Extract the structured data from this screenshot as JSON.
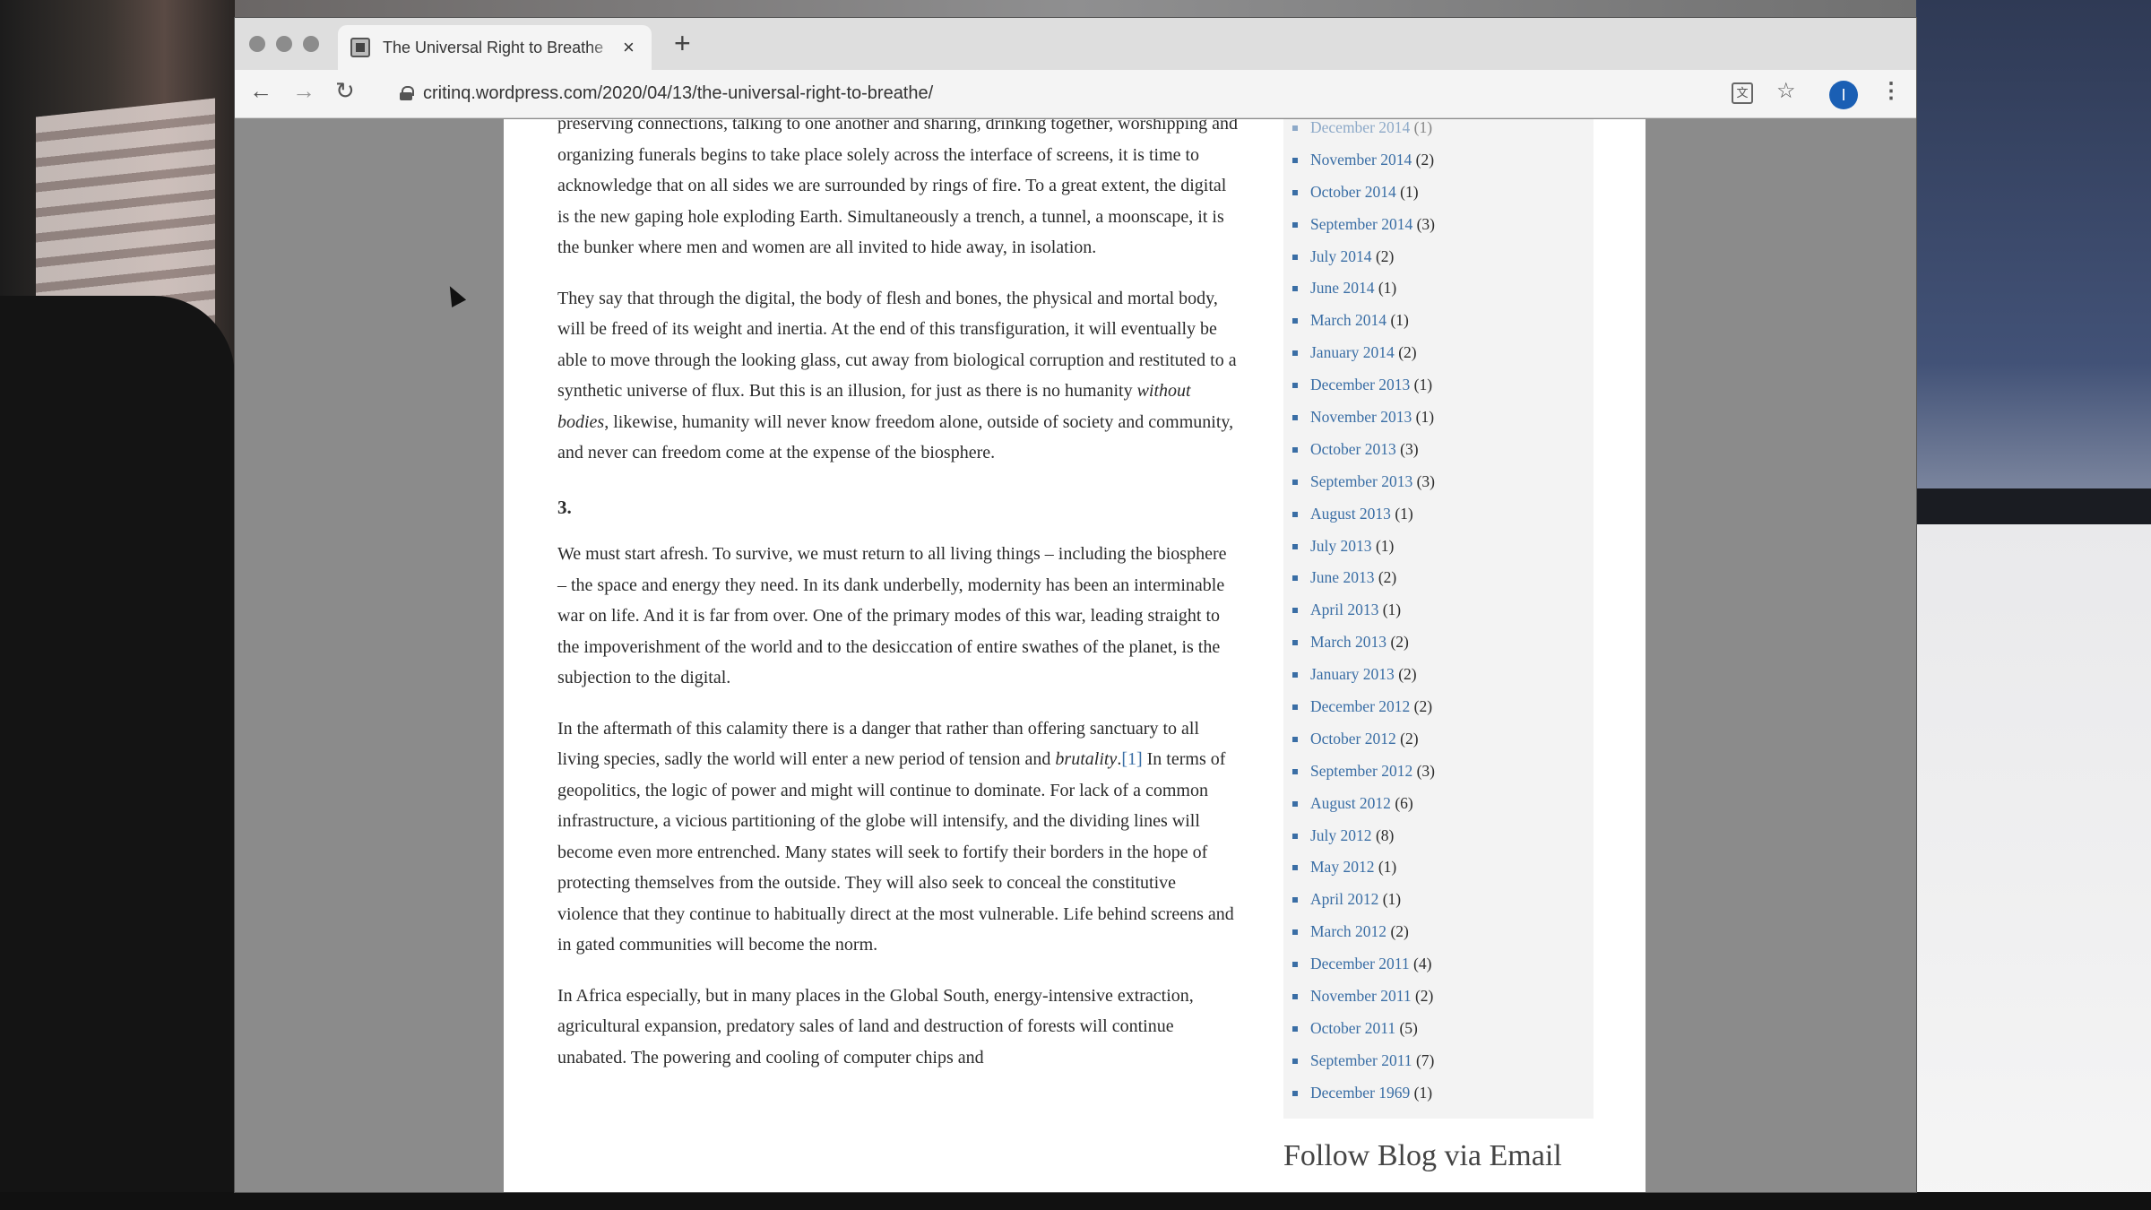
{
  "browser": {
    "tab_title": "The Universal Right to Breathe",
    "tab_close": "×",
    "new_tab": "+",
    "url": "critinq.wordpress.com/2020/04/13/the-universal-right-to-breathe/",
    "profile_initial": "I",
    "nav": {
      "back": "←",
      "forward": "→",
      "reload": "↻"
    },
    "icons": {
      "translate": "文",
      "star": "☆",
      "menu": "⋮"
    }
  },
  "article": {
    "para1": "preserving connections, talking to one another and sharing, drinking together, worshipping and organizing funerals begins to take place solely across the interface of screens, it is time to acknowledge that on all sides we are surrounded by rings of fire. To a great extent, the digital is the new gaping hole exploding Earth. Simultaneously a trench, a tunnel, a moonscape, it is the bunker where men and women are all invited to hide away, in isolation.",
    "para2_a": "They say that through the digital, the body of flesh and bones, the physical and mortal body, will be freed of its weight and inertia. At the end of this transfiguration, it will eventually be able to move through the looking glass, cut away from biological corruption and restituted to a synthetic universe of flux. But this is an illusion, for just as there is no humanity ",
    "para2_em": "without bodies",
    "para2_b": ", likewise, humanity will never know freedom alone, outside of society and community, and never can freedom come at the expense of the biosphere.",
    "section_heading": "3.",
    "para3": "We must start afresh. To survive, we must return to all living things – including the biosphere – the space and energy they need. In its dank underbelly, modernity has been an interminable war on life. And it is far from over. One of the primary modes of this war, leading straight to the impoverishment of the world and to the desiccation of entire swathes of the planet, is the subjection to the digital.",
    "para4_a": "In the aftermath of this calamity there is a danger that rather than offering sanctuary to all living species, sadly the world will enter a new period of tension and ",
    "para4_em": "brutality",
    "para4_dot": ".",
    "para4_ref": "[1]",
    "para4_b": " In terms of geopolitics, the logic of power and might will continue to dominate. For lack of a common infrastructure, a vicious partitioning of the globe will intensify, and the dividing lines will become even more entrenched. Many states will seek to fortify their borders in the hope of protecting themselves from the outside. They will also seek to conceal the constitutive violence that they continue to habitually direct at the most vulnerable. Life behind screens and in gated communities will become the norm.",
    "para5": "In Africa especially, but in many places in the Global South, energy-intensive extraction, agricultural expansion, predatory sales of land and destruction of forests will continue unabated. The powering and cooling of computer chips and"
  },
  "sidebar": {
    "archives": [
      {
        "month": "December 2014",
        "count": "(1)"
      },
      {
        "month": "November 2014",
        "count": "(2)"
      },
      {
        "month": "October 2014",
        "count": "(1)"
      },
      {
        "month": "September 2014",
        "count": "(3)"
      },
      {
        "month": "July 2014",
        "count": "(2)"
      },
      {
        "month": "June 2014",
        "count": "(1)"
      },
      {
        "month": "March 2014",
        "count": "(1)"
      },
      {
        "month": "January 2014",
        "count": "(2)"
      },
      {
        "month": "December 2013",
        "count": "(1)"
      },
      {
        "month": "November 2013",
        "count": "(1)"
      },
      {
        "month": "October 2013",
        "count": "(3)"
      },
      {
        "month": "September 2013",
        "count": "(3)"
      },
      {
        "month": "August 2013",
        "count": "(1)"
      },
      {
        "month": "July 2013",
        "count": "(1)"
      },
      {
        "month": "June 2013",
        "count": "(2)"
      },
      {
        "month": "April 2013",
        "count": "(1)"
      },
      {
        "month": "March 2013",
        "count": "(2)"
      },
      {
        "month": "January 2013",
        "count": "(2)"
      },
      {
        "month": "December 2012",
        "count": "(2)"
      },
      {
        "month": "October 2012",
        "count": "(2)"
      },
      {
        "month": "September 2012",
        "count": "(3)"
      },
      {
        "month": "August 2012",
        "count": "(6)"
      },
      {
        "month": "July 2012",
        "count": "(8)"
      },
      {
        "month": "May 2012",
        "count": "(1)"
      },
      {
        "month": "April 2012",
        "count": "(1)"
      },
      {
        "month": "March 2012",
        "count": "(2)"
      },
      {
        "month": "December 2011",
        "count": "(4)"
      },
      {
        "month": "November 2011",
        "count": "(2)"
      },
      {
        "month": "October 2011",
        "count": "(5)"
      },
      {
        "month": "September 2011",
        "count": "(7)"
      },
      {
        "month": "December 1969",
        "count": "(1)"
      }
    ],
    "follow_title": "Follow Blog via Email"
  },
  "colors": {
    "link": "#3a6ea5",
    "profile": "#1a5fb4"
  }
}
